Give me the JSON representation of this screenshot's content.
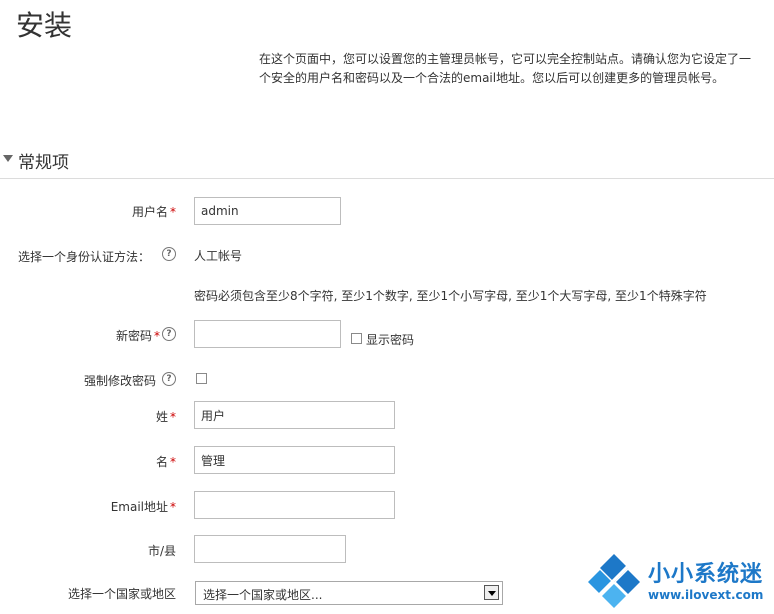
{
  "header": {
    "title": "安装",
    "intro": "在这个页面中，您可以设置您的主管理员帐号，它可以完全控制站点。请确认您为它设定了一个安全的用户名和密码以及一个合法的email地址。您以后可以创建更多的管理员帐号。"
  },
  "section": {
    "title": "常规项"
  },
  "form": {
    "username": {
      "label": "用户名",
      "required_mark": "*",
      "value": "admin"
    },
    "auth": {
      "label": "选择一个身份认证方法：",
      "help": "?",
      "value": "人工帐号"
    },
    "password_rules": "密码必须包含至少8个字符, 至少1个数字, 至少1个小写字母, 至少1个大写字母, 至少1个特殊字符",
    "new_password": {
      "label": "新密码",
      "required_mark": "*",
      "help": "?",
      "value": "",
      "show_label": "显示密码",
      "show_checked": false
    },
    "force_change": {
      "label": "强制修改密码",
      "help": "?",
      "checked": false
    },
    "lastname": {
      "label": "姓",
      "required_mark": "*",
      "value": "用户"
    },
    "firstname": {
      "label": "名",
      "required_mark": "*",
      "value": "管理"
    },
    "email": {
      "label": "Email地址",
      "required_mark": "*",
      "value": ""
    },
    "city": {
      "label": "市/县",
      "value": ""
    },
    "country": {
      "label": "选择一个国家或地区",
      "selected": "选择一个国家或地区..."
    }
  },
  "watermark": {
    "name": "小小系统迷",
    "url": "www.ilovext.com"
  },
  "colors": {
    "required": "#cc0000",
    "watermark": "#1d78c8"
  }
}
